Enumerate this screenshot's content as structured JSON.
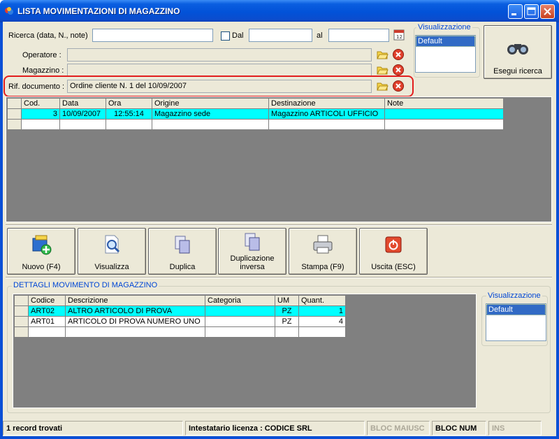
{
  "window": {
    "title": "LISTA MOVIMENTAZIONI DI MAGAZZINO"
  },
  "search": {
    "ricerca_label": "Ricerca (data, N., note)",
    "ricerca_value": "",
    "dal_label": "Dal",
    "dal_value": "",
    "al_label": "al",
    "al_value": "",
    "operatore_label": "Operatore :",
    "operatore_value": "",
    "magazzino_label": "Magazzino :",
    "magazzino_value": "",
    "rif_label": "Rif. documento :",
    "rif_value": "Ordine cliente N. 1 del 10/09/2007",
    "visualizzazione_title": "Visualizzazione",
    "visualizzazione_selected": "Default",
    "esegui_label": "Esegui ricerca"
  },
  "movimenti_grid": {
    "columns": [
      "Cod.",
      "Data",
      "Ora",
      "Origine",
      "Destinazione",
      "Note"
    ],
    "rows": [
      {
        "cod": "3",
        "data": "10/09/2007",
        "ora": "12:55:14",
        "origine": "Magazzino sede",
        "destinazione": "Magazzino ARTICOLI UFFICIO",
        "note": ""
      }
    ]
  },
  "toolbar": {
    "nuovo": "Nuovo (F4)",
    "visualizza": "Visualizza",
    "duplica": "Duplica",
    "duplicazione_1": "Duplicazione",
    "duplicazione_2": "inversa",
    "stampa": "Stampa (F9)",
    "uscita": "Uscita (ESC)"
  },
  "dettagli": {
    "title": "DETTAGLI MOVIMENTO DI MAGAZZINO",
    "columns": [
      "Codice",
      "Descrizione",
      "Categoria",
      "UM",
      "Quant."
    ],
    "rows": [
      {
        "codice": "ART02",
        "descrizione": "ALTRO ARTICOLO DI PROVA",
        "categoria": "",
        "um": "PZ",
        "quant": "1"
      },
      {
        "codice": "ART01",
        "descrizione": "ARTICOLO DI PROVA NUMERO UNO",
        "categoria": "",
        "um": "PZ",
        "quant": "4"
      }
    ],
    "visualizzazione_title": "Visualizzazione",
    "visualizzazione_selected": "Default"
  },
  "statusbar": {
    "records": "1 record trovati",
    "licenza": "Intestatario licenza : CODICE SRL",
    "bloc_maiusc": "BLOC MAIUSC",
    "bloc_num": "BLOC NUM",
    "ins": "INS"
  },
  "colors": {
    "title_bar": "#0252d8",
    "selected_row": "#00ffff",
    "highlight_box": "#e21e1e",
    "group_title": "#0046d5"
  }
}
